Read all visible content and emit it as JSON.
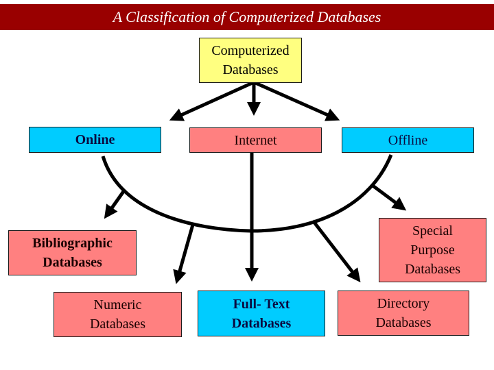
{
  "title": "A Classification of Computerized Databases",
  "colors": {
    "banner": "#990000",
    "root": "#ffff80",
    "blue_node": "#00ccff",
    "pink_node": "#ff8080",
    "connector": "#000000"
  },
  "nodes": {
    "root": "Computerized\nDatabases",
    "online": "Online",
    "internet": "Internet",
    "offline": "Offline",
    "bibliographic": "Bibliographic\nDatabases",
    "numeric": "Numeric\nDatabases",
    "fulltext": "Full- Text\nDatabases",
    "directory": "Directory\nDatabases",
    "special": "Special\nPurpose\nDatabases"
  },
  "edges": [
    {
      "from": "root",
      "to": "online"
    },
    {
      "from": "root",
      "to": "internet"
    },
    {
      "from": "root",
      "to": "offline"
    },
    {
      "from": "online/internet/offline",
      "to": "bibliographic"
    },
    {
      "from": "online/internet/offline",
      "to": "numeric"
    },
    {
      "from": "online/internet/offline",
      "to": "fulltext"
    },
    {
      "from": "online/internet/offline",
      "to": "directory"
    },
    {
      "from": "online/internet/offline",
      "to": "special"
    }
  ]
}
